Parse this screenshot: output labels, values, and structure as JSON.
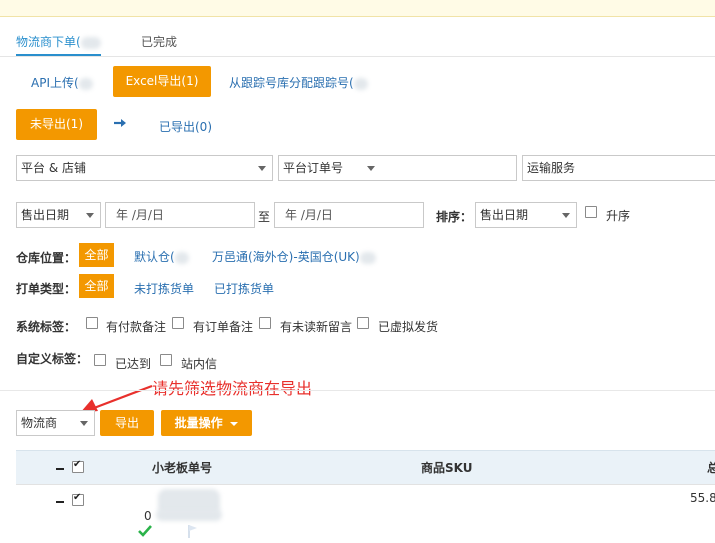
{
  "tabs": {
    "logistics_order": "物流商下单(",
    "completed": "已完成"
  },
  "upload_tabs": {
    "api": "API上传(",
    "excel": "Excel导出(1)",
    "tracking": "从跟踪号库分配跟踪号("
  },
  "export_status": {
    "not_exported": "未导出(1)",
    "exported": "已导出(0)"
  },
  "filters": {
    "platform_store": "平台 & 店铺",
    "platform_order_no": "平台订单号",
    "shipping_service": "运输服务",
    "date_type": "售出日期",
    "date_placeholder": "年 /月/日",
    "to": "至",
    "sort_label": "排序：",
    "sort_value": "售出日期",
    "ascending": "升序"
  },
  "warehouse": {
    "label": "仓库位置：",
    "all": "全部",
    "default": "默认仓(",
    "overseas": "万邑通(海外仓)-英国仓(UK)"
  },
  "pick_type": {
    "label": "打单类型：",
    "all": "全部",
    "unpicked": "未打拣货单",
    "picked": "已打拣货单"
  },
  "system_tags": {
    "label": "系统标签：",
    "items": [
      "有付款备注",
      "有订单备注",
      "有未读新留言",
      "已虚拟发货"
    ]
  },
  "custom_tags": {
    "label": "自定义标签：",
    "items": [
      "已达到",
      "站内信"
    ]
  },
  "annotation": "请先筛选物流商在导出",
  "actions": {
    "carrier_select": "物流商",
    "export": "导出",
    "batch": "批量操作"
  },
  "table": {
    "headers": [
      "小老板单号",
      "商品SKU",
      "总"
    ],
    "row": {
      "order_prefix": "0",
      "amount": "55.8"
    }
  },
  "colors": {
    "accent": "#f39800",
    "link": "#2a6fb0",
    "tab_active": "#2a8fcd",
    "annotation": "#e8302c",
    "check": "#2bb34a"
  }
}
